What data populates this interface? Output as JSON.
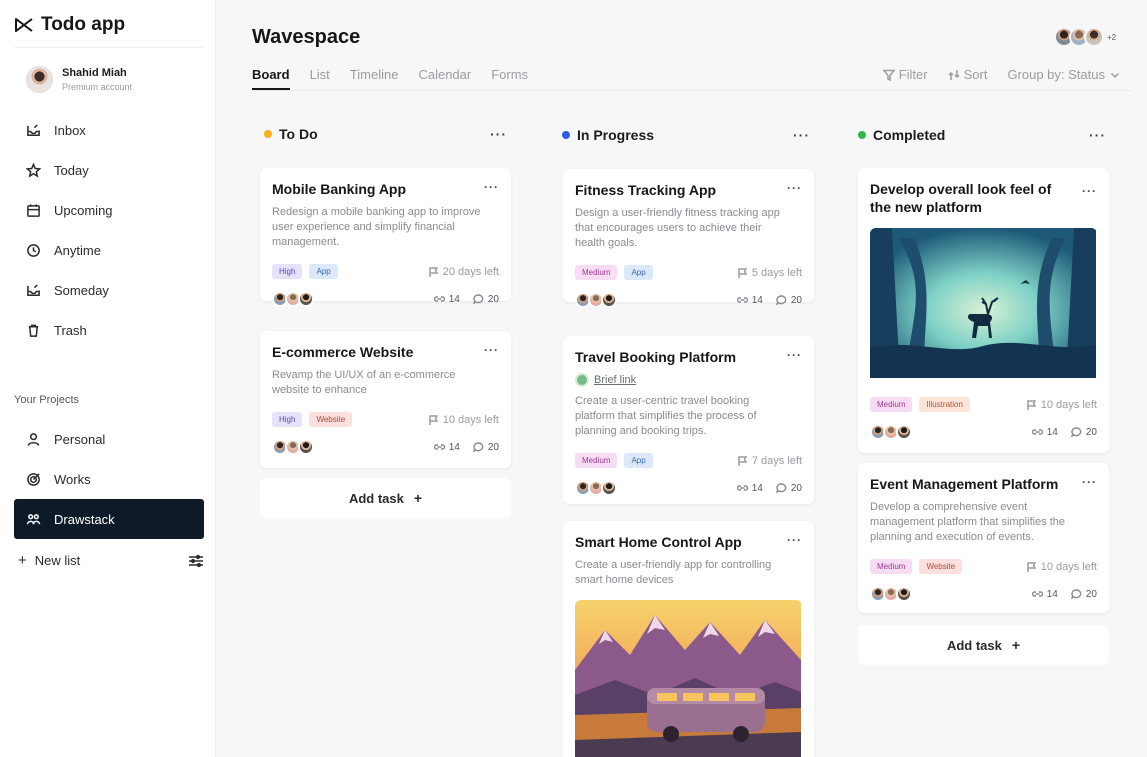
{
  "app": {
    "name": "Todo app"
  },
  "user": {
    "name": "Shahid Miah",
    "plan": "Premium account"
  },
  "nav": [
    {
      "label": "Inbox",
      "icon": "inbox-icon"
    },
    {
      "label": "Today",
      "icon": "star-icon"
    },
    {
      "label": "Upcoming",
      "icon": "calendar-icon"
    },
    {
      "label": "Anytime",
      "icon": "clock-icon"
    },
    {
      "label": "Someday",
      "icon": "inbox-stack-icon"
    },
    {
      "label": "Trash",
      "icon": "trash-icon"
    }
  ],
  "projects": {
    "title": "Your Projects",
    "items": [
      {
        "label": "Personal",
        "icon": "person-icon"
      },
      {
        "label": "Works",
        "icon": "target-icon"
      },
      {
        "label": "Drawstack",
        "icon": "team-icon",
        "active": true
      }
    ],
    "new_list": "New list"
  },
  "workspace": {
    "title": "Wavespace",
    "members_more": "+2",
    "tabs": [
      "Board",
      "List",
      "Timeline",
      "Calendar",
      "Forms"
    ],
    "active_tab": "Board",
    "tools": {
      "filter": "Filter",
      "sort": "Sort",
      "group": "Group by: Status"
    }
  },
  "columns": [
    {
      "title": "To Do",
      "color": "#f5b21b",
      "cards": [
        {
          "title": "Mobile Banking App",
          "desc": "Redesign a mobile banking app to improve user experience and simplify financial management.",
          "tags": [
            "High",
            "App"
          ],
          "due": "20 days left",
          "links": "14",
          "comments": "20"
        },
        {
          "title": "E-commerce Website",
          "desc": "Revamp the UI/UX of an e-commerce website to enhance",
          "tags": [
            "High",
            "Website"
          ],
          "due": "10 days left",
          "links": "14",
          "comments": "20"
        }
      ],
      "add": "Add task"
    },
    {
      "title": "In Progress",
      "color": "#2b5fe0",
      "cards": [
        {
          "title": "Fitness Tracking App",
          "desc": "Design a user-friendly fitness tracking app that encourages users to achieve their health goals.",
          "tags": [
            "Medium",
            "App"
          ],
          "due": "5 days left",
          "links": "14",
          "comments": "20"
        },
        {
          "title": "Travel Booking Platform",
          "brief": "Brief link",
          "desc": "Create a user-centric travel booking platform that simplifies the process of planning and booking trips.",
          "tags": [
            "Medium",
            "App"
          ],
          "due": "7 days left",
          "links": "14",
          "comments": "20"
        },
        {
          "title": "Smart Home Control App",
          "desc": "Create a user-friendly app for controlling smart home devices"
        }
      ]
    },
    {
      "title": "Completed",
      "color": "#2fb84a",
      "cards": [
        {
          "title": "Develop overall look feel of the new platform",
          "tags": [
            "Medium",
            "Illustration"
          ],
          "due": "10 days left",
          "links": "14",
          "comments": "20"
        },
        {
          "title": "Event Management Platform",
          "desc": "Develop a comprehensive event management platform that simplifies the planning and execution of events.",
          "tags": [
            "Medium",
            "Website"
          ],
          "due": "10 days left",
          "links": "14",
          "comments": "20"
        }
      ],
      "add": "Add task"
    }
  ]
}
